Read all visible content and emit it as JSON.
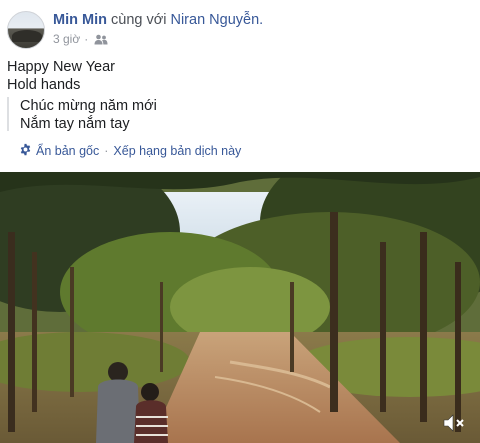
{
  "header": {
    "author": "Min Min",
    "with_text": "cùng với",
    "tagged": "Niran Nguyễn.",
    "time": "3 giờ",
    "separator": "·",
    "audience_icon": "friends-icon"
  },
  "post": {
    "line1": "Happy New Year",
    "line2": "Hold hands"
  },
  "translation": {
    "line1": "Chúc mừng năm mới",
    "line2": "Nắm tay nắm tay",
    "settings_icon": "gear-icon",
    "show_original": "Ẩn bản gốc",
    "separator": "·",
    "rate": "Xếp hạng bản dịch này"
  },
  "video": {
    "sound_icon": "muted-speaker-icon"
  }
}
